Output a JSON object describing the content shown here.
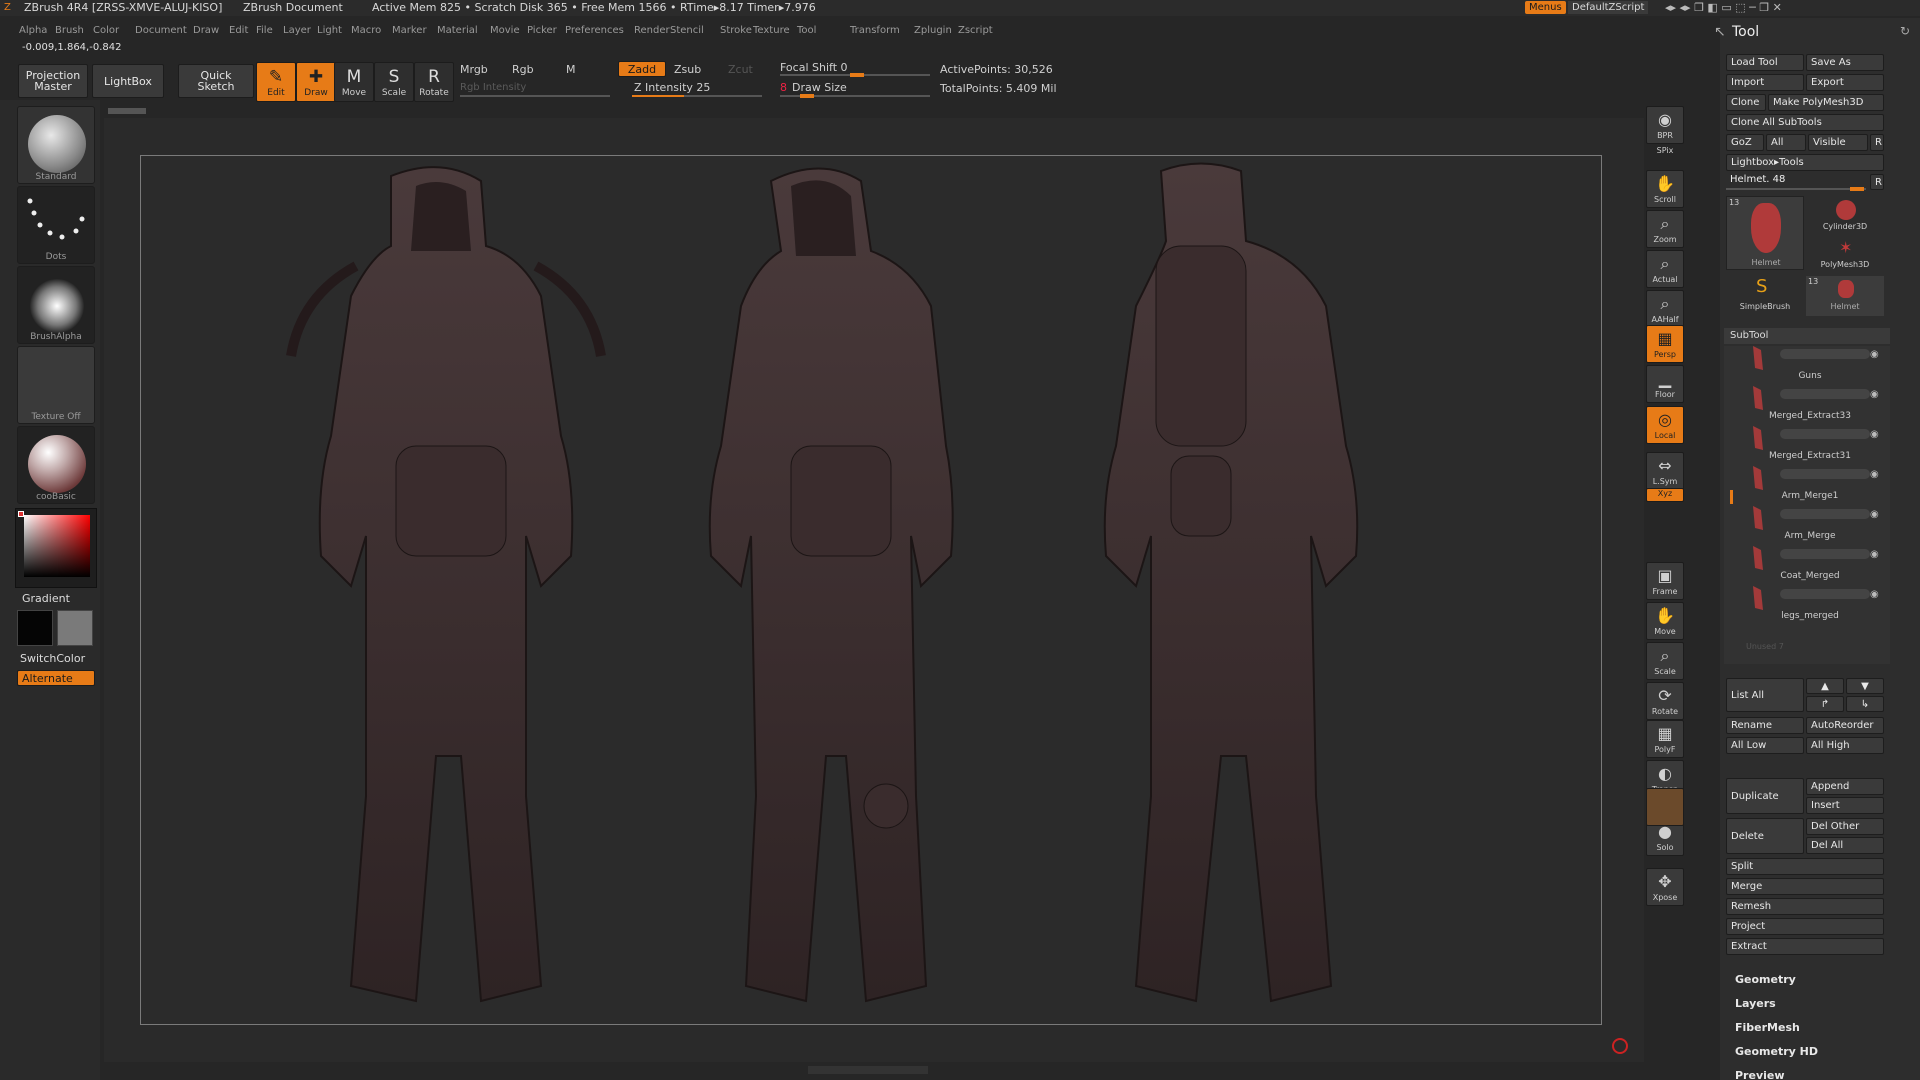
{
  "titlebar": {
    "app": "ZBrush 4R4 [ZRSS-XMVE-ALUJ-KISO]",
    "document": "ZBrush Document",
    "stats": "Active Mem 825  •  Scratch Disk 365  •  Free Mem 1566  •  RTime▸8.17  Timer▸7.976",
    "menus_btn": "Menus",
    "script": "DefaultZScript"
  },
  "menubar": [
    "Alpha",
    "Brush",
    "Color",
    "Document",
    "Draw",
    "Edit",
    "File",
    "Layer",
    "Light",
    "Macro",
    "Marker",
    "Material",
    "Movie",
    "Picker",
    "Preferences",
    "Render",
    "Stencil",
    "Stroke",
    "Texture",
    "Tool",
    "Transform",
    "Zplugin",
    "Zscript"
  ],
  "coords": "-0.009,1.864,-0.842",
  "toolbar": {
    "projection_master": "Projection Master",
    "lightbox": "LightBox",
    "quick_sketch": "Quick Sketch",
    "edit": "Edit",
    "draw": "Draw",
    "move": "Move",
    "scale": "Scale",
    "rotate": "Rotate",
    "mrgb": "Mrgb",
    "rgb": "Rgb",
    "m": "M",
    "rgb_intensity": "Rgb Intensity",
    "zadd": "Zadd",
    "zsub": "Zsub",
    "zcut": "Zcut",
    "z_intensity": "Z Intensity 25",
    "z_intensity_value": 25,
    "focal_shift": "Focal Shift 0",
    "draw_size": "Draw Size",
    "draw_size_num": "8",
    "active_points": "ActivePoints: 30,526",
    "total_points": "TotalPoints: 5.409 Mil"
  },
  "leftshelf": {
    "items": [
      "Standard",
      "Dots",
      "BrushAlpha",
      "Texture Off",
      "cooBasic"
    ],
    "gradient": "Gradient",
    "switch_color": "SwitchColor",
    "alternate": "Alternate"
  },
  "rightshelf": [
    "BPR",
    "SPix",
    "Scroll",
    "Zoom",
    "Actual",
    "AAHalf",
    "Persp",
    "Floor",
    "Local",
    "L.Sym",
    "Xyz",
    "Frame",
    "Move",
    "Scale",
    "Rotate",
    "PolyF",
    "Transp",
    "Solo",
    "Xpose"
  ],
  "toolpanel": {
    "title": "Tool",
    "load_tool": "Load Tool",
    "save_as": "Save As",
    "import": "Import",
    "export": "Export",
    "clone": "Clone",
    "make_polymesh": "Make PolyMesh3D",
    "clone_all": "Clone All SubTools",
    "goz": "GoZ",
    "all": "All",
    "visible": "Visible",
    "r": "R",
    "lightbox_tools": "Lightbox▸Tools",
    "helmet_slider": "Helmet. 48",
    "thumbs": [
      {
        "label": "Helmet",
        "count": "13"
      },
      {
        "label": "Cylinder3D"
      },
      {
        "label": "PolyMesh3D"
      },
      {
        "label": "SimpleBrush"
      },
      {
        "label": "Helmet",
        "count": "13"
      }
    ],
    "subtool_title": "SubTool",
    "subtools": [
      "Guns",
      "Merged_Extract33",
      "Merged_Extract31",
      "Arm_Merge1",
      "Arm_Merge",
      "Coat_Merged",
      "legs_merged"
    ],
    "unused": "Unused 7",
    "list_all": "List All",
    "rename": "Rename",
    "autoreorder": "AutoReorder",
    "all_low": "All Low",
    "all_high": "All High",
    "duplicate": "Duplicate",
    "append": "Append",
    "insert": "Insert",
    "delete": "Delete",
    "del_other": "Del Other",
    "del_all": "Del All",
    "split": "Split",
    "merge": "Merge",
    "remesh": "Remesh",
    "project": "Project",
    "extract": "Extract",
    "geometry": "Geometry",
    "layers": "Layers",
    "fibermesh": "FiberMesh",
    "geometry_hd": "Geometry HD",
    "preview": "Preview"
  },
  "colors": {
    "accent": "#e77b17",
    "model": "#3c2e2f"
  }
}
